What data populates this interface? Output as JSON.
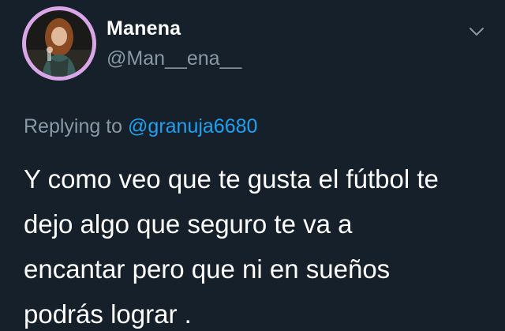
{
  "user": {
    "display_name": "Manena",
    "handle": "@Man__ena__",
    "avatar_ring_color": "#d9a6e8"
  },
  "reply": {
    "prefix": "Replying to",
    "mention": "@granuja6680"
  },
  "tweet": {
    "lines": [
      "Y como veo que te gusta el fútbol te",
      "dejo algo que seguro te va a",
      "encantar pero que ni en sueños",
      "podrás lograr ."
    ]
  },
  "menu": {
    "icon": "chevron-down-icon"
  },
  "colors": {
    "background": "#15202b",
    "primary_text": "#ffffff",
    "secondary_text": "#8899a6",
    "link": "#1da1f2"
  }
}
